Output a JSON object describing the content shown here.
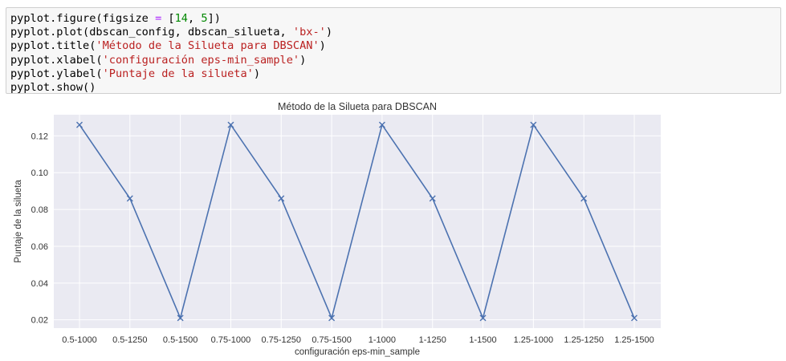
{
  "code_cell": {
    "lines": [
      [
        {
          "t": "pyplot.figure(figsize ",
          "k": "plain"
        },
        {
          "t": "=",
          "k": "kw"
        },
        {
          "t": " [",
          "k": "plain"
        },
        {
          "t": "14",
          "k": "num"
        },
        {
          "t": ", ",
          "k": "plain"
        },
        {
          "t": "5",
          "k": "num"
        },
        {
          "t": "])",
          "k": "plain"
        }
      ],
      [
        {
          "t": "pyplot.plot(dbscan_config, dbscan_silueta, ",
          "k": "plain"
        },
        {
          "t": "'bx-'",
          "k": "str"
        },
        {
          "t": ")",
          "k": "plain"
        }
      ],
      [
        {
          "t": "pyplot.title(",
          "k": "plain"
        },
        {
          "t": "'Método de la Silueta para DBSCAN'",
          "k": "str"
        },
        {
          "t": ")",
          "k": "plain"
        }
      ],
      [
        {
          "t": "pyplot.xlabel(",
          "k": "plain"
        },
        {
          "t": "'configuración eps-min_sample'",
          "k": "str"
        },
        {
          "t": ")",
          "k": "plain"
        }
      ],
      [
        {
          "t": "pyplot.ylabel(",
          "k": "plain"
        },
        {
          "t": "'Puntaje de la silueta'",
          "k": "str"
        },
        {
          "t": ")",
          "k": "plain"
        }
      ],
      [
        {
          "t": "pyplot.show()",
          "k": "plain"
        }
      ]
    ]
  },
  "colors": {
    "plot_bg": "#eaeaf2",
    "grid": "#ffffff",
    "line": "#4c72b0",
    "text": "#333333",
    "code_kw": "#aa22ff",
    "code_num": "#008800",
    "code_str": "#ba2121"
  },
  "chart_data": {
    "type": "line",
    "title": "Método de la Silueta para DBSCAN",
    "xlabel": "configuración eps-min_sample",
    "ylabel": "Puntaje de la silueta",
    "categories": [
      "0.5-1000",
      "0.5-1250",
      "0.5-1500",
      "0.75-1000",
      "0.75-1250",
      "0.75-1500",
      "1-1000",
      "1-1250",
      "1-1500",
      "1.25-1000",
      "1.25-1250",
      "1.25-1500"
    ],
    "values": [
      0.126,
      0.086,
      0.021,
      0.126,
      0.086,
      0.021,
      0.126,
      0.086,
      0.021,
      0.126,
      0.086,
      0.021
    ],
    "yticks": [
      0.02,
      0.04,
      0.06,
      0.08,
      0.1,
      0.12
    ],
    "ytick_labels": [
      "0.02",
      "0.04",
      "0.06",
      "0.08",
      "0.10",
      "0.12"
    ],
    "ylim": [
      0.0155,
      0.1315
    ],
    "marker": "x",
    "grid": true
  }
}
